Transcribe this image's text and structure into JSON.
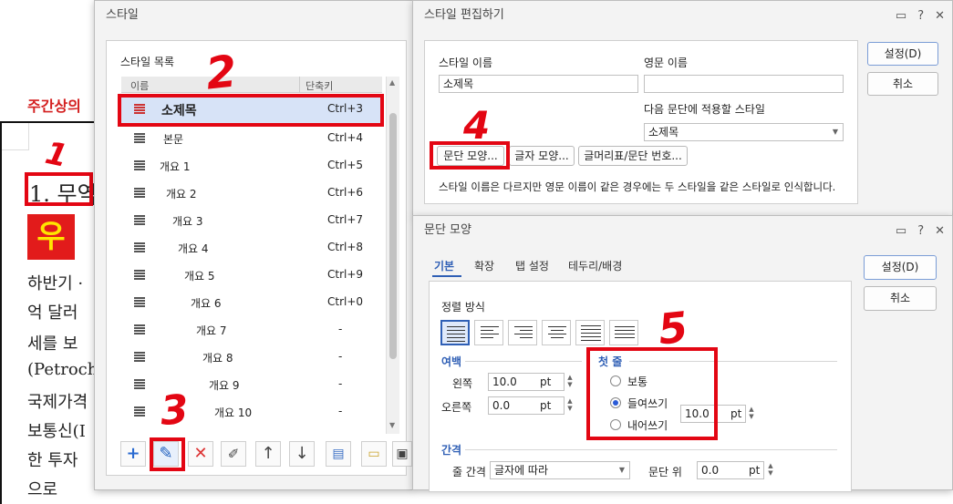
{
  "document": {
    "heading": "주간상의",
    "title": "1. 무역",
    "logo_char": "우",
    "small_side": [
      "",
      ""
    ],
    "lines": [
      "하반기 ·",
      "억 달러",
      "세를 보",
      "(Petroch",
      "국제가격",
      "보통신(I",
      "한 투자",
      "으로"
    ]
  },
  "style_window": {
    "title": "스타일",
    "list_label": "스타일 목록",
    "col_name": "이름",
    "col_shortcut": "단축키",
    "items": [
      {
        "name": "소제목",
        "key": "Ctrl+3"
      },
      {
        "name": "본문",
        "key": "Ctrl+4"
      },
      {
        "name": "개요 1",
        "key": "Ctrl+5"
      },
      {
        "name": "개요 2",
        "key": "Ctrl+6"
      },
      {
        "name": "개요 3",
        "key": "Ctrl+7"
      },
      {
        "name": "개요 4",
        "key": "Ctrl+8"
      },
      {
        "name": "개요 5",
        "key": "Ctrl+9"
      },
      {
        "name": "개요 6",
        "key": "Ctrl+0"
      },
      {
        "name": "개요 7",
        "key": "-"
      },
      {
        "name": "개요 8",
        "key": "-"
      },
      {
        "name": "개요 9",
        "key": "-"
      },
      {
        "name": "개요 10",
        "key": "-"
      }
    ]
  },
  "edit_window": {
    "title": "스타일 편집하기",
    "style_name_label": "스타일 이름",
    "style_name_value": "소제목",
    "eng_name_label": "영문 이름",
    "eng_name_value": "",
    "next_style_label": "다음 문단에 적용할 스타일",
    "next_style_value": "소제목",
    "btn_paragraph": "문단 모양...",
    "btn_char": "글자 모양...",
    "btn_bullet": "글머리표/문단 번호...",
    "note": "스타일 이름은 다르지만 영문 이름이 같은 경우에는 두 스타일을 같은 스타일로 인식합니다.",
    "ok": "설정(D)",
    "cancel": "취소"
  },
  "para_window": {
    "title": "문단 모양",
    "tabs": [
      "기본",
      "확장",
      "탭 설정",
      "테두리/배경"
    ],
    "align_label": "정렬 방식",
    "margin_label": "여백",
    "left_label": "왼쪽",
    "left_value": "10.0",
    "right_label": "오른쪽",
    "right_value": "0.0",
    "unit": "pt",
    "first_line_label": "첫 줄",
    "opt_normal": "보통",
    "opt_indent": "들여쓰기",
    "opt_outdent": "내어쓰기",
    "indent_value": "10.0",
    "spacing_label": "간격",
    "line_spacing_label": "줄 간격",
    "line_spacing_value": "글자에 따라",
    "para_above_label": "문단 위",
    "para_above_value": "0.0",
    "ok": "설정(D)",
    "cancel": "취소"
  },
  "annotations": [
    "1",
    "2",
    "3",
    "4",
    "5"
  ],
  "colors": {
    "accent": "#e30613",
    "selection": "#d7e3f7",
    "link_blue": "#2f5fb5"
  }
}
